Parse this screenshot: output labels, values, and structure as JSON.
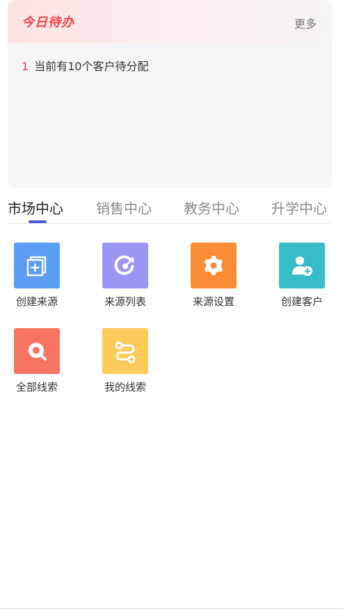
{
  "todo": {
    "title": "今日待办",
    "more": "更多",
    "items": [
      {
        "index": "1",
        "text": "当前有10个客户待分配"
      }
    ]
  },
  "tabs": [
    {
      "label": "市场中心",
      "active": true
    },
    {
      "label": "销售中心",
      "active": false
    },
    {
      "label": "教务中心",
      "active": false
    },
    {
      "label": "升学中心",
      "active": false
    }
  ],
  "functions": [
    {
      "label": "创建来源",
      "icon": "add-copy-icon",
      "color": "#5b9cf5"
    },
    {
      "label": "来源列表",
      "icon": "target-icon",
      "color": "#9b95f3"
    },
    {
      "label": "来源设置",
      "icon": "gear-icon",
      "color": "#fb8c36"
    },
    {
      "label": "创建客户",
      "icon": "add-user-icon",
      "color": "#38bcc8"
    },
    {
      "label": "全部线索",
      "icon": "search-icon",
      "color": "#f77463"
    },
    {
      "label": "我的线索",
      "icon": "route-icon",
      "color": "#fccb5b"
    }
  ],
  "colors": {
    "accent_red": "#f4424a",
    "tab_indicator": "#4b56d8"
  }
}
